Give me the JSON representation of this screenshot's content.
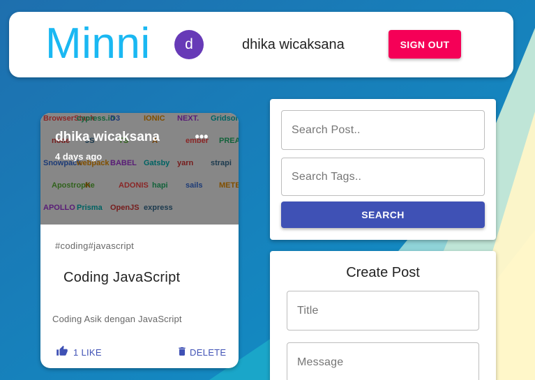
{
  "header": {
    "brand": "Minni",
    "avatar_initial": "d",
    "avatar_color": "#673ab7",
    "username": "dhika wicaksana",
    "signout_label": "SIGN OUT",
    "signout_color": "#f50057"
  },
  "post": {
    "author": "dhika wicaksana",
    "time": "4 days ago",
    "more_icon": "more-horiz-icon",
    "tags": "#coding#javascript",
    "title": "Coding JavaScript",
    "message": "Coding Asik dengan JavaScript",
    "like_label": "1 LIKE",
    "delete_label": "DELETE",
    "image_tiles": [
      "BrowserStack",
      "cypress.io",
      "D3",
      "IONIC",
      "NEXT.",
      "Gridsome",
      "node",
      "JS",
      "TS",
      "A",
      "ember",
      "PREACT",
      "Snowpack",
      "webpack",
      "BABEL",
      "Gatsby",
      "yarn",
      "strapi",
      "Apostrophe",
      "K",
      "ADONIS",
      "hapi",
      "sails",
      "METEOR",
      "APOLLO",
      "Prisma",
      "OpenJS",
      "express"
    ]
  },
  "search": {
    "post_placeholder": "Search Post..",
    "tags_placeholder": "Search Tags..",
    "button_label": "SEARCH",
    "button_color": "#3f51b5"
  },
  "create": {
    "title": "Create Post",
    "title_placeholder": "Title",
    "message_placeholder": "Message"
  }
}
